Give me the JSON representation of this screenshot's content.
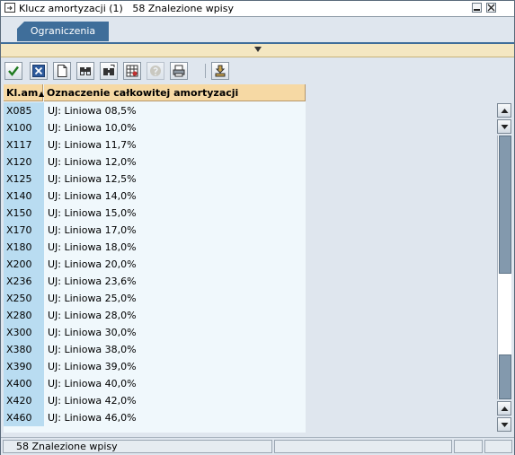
{
  "window": {
    "title": "Klucz amortyzacji (1)   58 Znalezione wpisy"
  },
  "tabs": [
    {
      "label": "Ograniczenia"
    }
  ],
  "toolbar": {
    "buttons": [
      {
        "icon": "checkmark-icon"
      },
      {
        "icon": "cancel-icon"
      },
      {
        "icon": "new-document-icon"
      },
      {
        "icon": "binoculars-find-icon"
      },
      {
        "icon": "binoculars-find-next-icon"
      },
      {
        "icon": "grid-settings-icon"
      },
      {
        "icon": "help-icon",
        "disabled": true
      },
      {
        "icon": "print-icon"
      },
      {
        "icon": "filter-icon"
      }
    ]
  },
  "grid": {
    "columns": [
      "Kl.am",
      "Oznaczenie całkowitej amortyzacji"
    ],
    "rows": [
      [
        "X085",
        "UJ: Liniowa 08,5%"
      ],
      [
        "X100",
        "UJ: Liniowa 10,0%"
      ],
      [
        "X117",
        "UJ: Liniowa 11,7%"
      ],
      [
        "X120",
        "UJ: Liniowa 12,0%"
      ],
      [
        "X125",
        "UJ: Liniowa 12,5%"
      ],
      [
        "X140",
        "UJ: Liniowa 14,0%"
      ],
      [
        "X150",
        "UJ: Liniowa 15,0%"
      ],
      [
        "X170",
        "UJ: Liniowa 17,0%"
      ],
      [
        "X180",
        "UJ: Liniowa 18,0%"
      ],
      [
        "X200",
        "UJ: Liniowa 20,0%"
      ],
      [
        "X236",
        "UJ: Liniowa 23,6%"
      ],
      [
        "X250",
        "UJ: Liniowa 25,0%"
      ],
      [
        "X280",
        "UJ: Liniowa 28,0%"
      ],
      [
        "X300",
        "UJ: Liniowa 30,0%"
      ],
      [
        "X380",
        "UJ: Liniowa 38,0%"
      ],
      [
        "X390",
        "UJ: Liniowa 39,0%"
      ],
      [
        "X400",
        "UJ: Liniowa 40,0%"
      ],
      [
        "X420",
        "UJ: Liniowa 42,0%"
      ],
      [
        "X460",
        "UJ: Liniowa 46,0%"
      ]
    ]
  },
  "statusbar": {
    "text": "58 Znalezione wpisy"
  }
}
